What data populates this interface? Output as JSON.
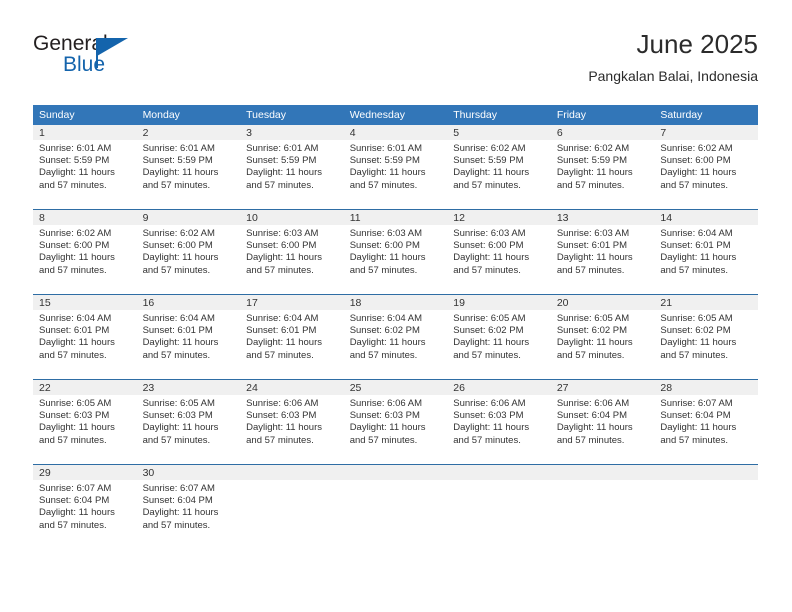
{
  "brand": {
    "name_part1": "General",
    "name_part2": "Blue",
    "logo_icon": "triangle-flag-icon",
    "accent_color": "#1464ac"
  },
  "header": {
    "title": "June 2025",
    "subtitle": "Pangkalan Balai, Indonesia"
  },
  "colors": {
    "header_row_bg": "#3276b8",
    "week_separator": "#2e6da4",
    "daynum_strip_bg": "#f0f0f0",
    "text": "#333333"
  },
  "calendar": {
    "weekday_headers": [
      "Sunday",
      "Monday",
      "Tuesday",
      "Wednesday",
      "Thursday",
      "Friday",
      "Saturday"
    ],
    "weeks": [
      [
        {
          "day": "1",
          "sunrise": "Sunrise: 6:01 AM",
          "sunset": "Sunset: 5:59 PM",
          "daylight_line1": "Daylight: 11 hours",
          "daylight_line2": "and 57 minutes."
        },
        {
          "day": "2",
          "sunrise": "Sunrise: 6:01 AM",
          "sunset": "Sunset: 5:59 PM",
          "daylight_line1": "Daylight: 11 hours",
          "daylight_line2": "and 57 minutes."
        },
        {
          "day": "3",
          "sunrise": "Sunrise: 6:01 AM",
          "sunset": "Sunset: 5:59 PM",
          "daylight_line1": "Daylight: 11 hours",
          "daylight_line2": "and 57 minutes."
        },
        {
          "day": "4",
          "sunrise": "Sunrise: 6:01 AM",
          "sunset": "Sunset: 5:59 PM",
          "daylight_line1": "Daylight: 11 hours",
          "daylight_line2": "and 57 minutes."
        },
        {
          "day": "5",
          "sunrise": "Sunrise: 6:02 AM",
          "sunset": "Sunset: 5:59 PM",
          "daylight_line1": "Daylight: 11 hours",
          "daylight_line2": "and 57 minutes."
        },
        {
          "day": "6",
          "sunrise": "Sunrise: 6:02 AM",
          "sunset": "Sunset: 5:59 PM",
          "daylight_line1": "Daylight: 11 hours",
          "daylight_line2": "and 57 minutes."
        },
        {
          "day": "7",
          "sunrise": "Sunrise: 6:02 AM",
          "sunset": "Sunset: 6:00 PM",
          "daylight_line1": "Daylight: 11 hours",
          "daylight_line2": "and 57 minutes."
        }
      ],
      [
        {
          "day": "8",
          "sunrise": "Sunrise: 6:02 AM",
          "sunset": "Sunset: 6:00 PM",
          "daylight_line1": "Daylight: 11 hours",
          "daylight_line2": "and 57 minutes."
        },
        {
          "day": "9",
          "sunrise": "Sunrise: 6:02 AM",
          "sunset": "Sunset: 6:00 PM",
          "daylight_line1": "Daylight: 11 hours",
          "daylight_line2": "and 57 minutes."
        },
        {
          "day": "10",
          "sunrise": "Sunrise: 6:03 AM",
          "sunset": "Sunset: 6:00 PM",
          "daylight_line1": "Daylight: 11 hours",
          "daylight_line2": "and 57 minutes."
        },
        {
          "day": "11",
          "sunrise": "Sunrise: 6:03 AM",
          "sunset": "Sunset: 6:00 PM",
          "daylight_line1": "Daylight: 11 hours",
          "daylight_line2": "and 57 minutes."
        },
        {
          "day": "12",
          "sunrise": "Sunrise: 6:03 AM",
          "sunset": "Sunset: 6:00 PM",
          "daylight_line1": "Daylight: 11 hours",
          "daylight_line2": "and 57 minutes."
        },
        {
          "day": "13",
          "sunrise": "Sunrise: 6:03 AM",
          "sunset": "Sunset: 6:01 PM",
          "daylight_line1": "Daylight: 11 hours",
          "daylight_line2": "and 57 minutes."
        },
        {
          "day": "14",
          "sunrise": "Sunrise: 6:04 AM",
          "sunset": "Sunset: 6:01 PM",
          "daylight_line1": "Daylight: 11 hours",
          "daylight_line2": "and 57 minutes."
        }
      ],
      [
        {
          "day": "15",
          "sunrise": "Sunrise: 6:04 AM",
          "sunset": "Sunset: 6:01 PM",
          "daylight_line1": "Daylight: 11 hours",
          "daylight_line2": "and 57 minutes."
        },
        {
          "day": "16",
          "sunrise": "Sunrise: 6:04 AM",
          "sunset": "Sunset: 6:01 PM",
          "daylight_line1": "Daylight: 11 hours",
          "daylight_line2": "and 57 minutes."
        },
        {
          "day": "17",
          "sunrise": "Sunrise: 6:04 AM",
          "sunset": "Sunset: 6:01 PM",
          "daylight_line1": "Daylight: 11 hours",
          "daylight_line2": "and 57 minutes."
        },
        {
          "day": "18",
          "sunrise": "Sunrise: 6:04 AM",
          "sunset": "Sunset: 6:02 PM",
          "daylight_line1": "Daylight: 11 hours",
          "daylight_line2": "and 57 minutes."
        },
        {
          "day": "19",
          "sunrise": "Sunrise: 6:05 AM",
          "sunset": "Sunset: 6:02 PM",
          "daylight_line1": "Daylight: 11 hours",
          "daylight_line2": "and 57 minutes."
        },
        {
          "day": "20",
          "sunrise": "Sunrise: 6:05 AM",
          "sunset": "Sunset: 6:02 PM",
          "daylight_line1": "Daylight: 11 hours",
          "daylight_line2": "and 57 minutes."
        },
        {
          "day": "21",
          "sunrise": "Sunrise: 6:05 AM",
          "sunset": "Sunset: 6:02 PM",
          "daylight_line1": "Daylight: 11 hours",
          "daylight_line2": "and 57 minutes."
        }
      ],
      [
        {
          "day": "22",
          "sunrise": "Sunrise: 6:05 AM",
          "sunset": "Sunset: 6:03 PM",
          "daylight_line1": "Daylight: 11 hours",
          "daylight_line2": "and 57 minutes."
        },
        {
          "day": "23",
          "sunrise": "Sunrise: 6:05 AM",
          "sunset": "Sunset: 6:03 PM",
          "daylight_line1": "Daylight: 11 hours",
          "daylight_line2": "and 57 minutes."
        },
        {
          "day": "24",
          "sunrise": "Sunrise: 6:06 AM",
          "sunset": "Sunset: 6:03 PM",
          "daylight_line1": "Daylight: 11 hours",
          "daylight_line2": "and 57 minutes."
        },
        {
          "day": "25",
          "sunrise": "Sunrise: 6:06 AM",
          "sunset": "Sunset: 6:03 PM",
          "daylight_line1": "Daylight: 11 hours",
          "daylight_line2": "and 57 minutes."
        },
        {
          "day": "26",
          "sunrise": "Sunrise: 6:06 AM",
          "sunset": "Sunset: 6:03 PM",
          "daylight_line1": "Daylight: 11 hours",
          "daylight_line2": "and 57 minutes."
        },
        {
          "day": "27",
          "sunrise": "Sunrise: 6:06 AM",
          "sunset": "Sunset: 6:04 PM",
          "daylight_line1": "Daylight: 11 hours",
          "daylight_line2": "and 57 minutes."
        },
        {
          "day": "28",
          "sunrise": "Sunrise: 6:07 AM",
          "sunset": "Sunset: 6:04 PM",
          "daylight_line1": "Daylight: 11 hours",
          "daylight_line2": "and 57 minutes."
        }
      ],
      [
        {
          "day": "29",
          "sunrise": "Sunrise: 6:07 AM",
          "sunset": "Sunset: 6:04 PM",
          "daylight_line1": "Daylight: 11 hours",
          "daylight_line2": "and 57 minutes."
        },
        {
          "day": "30",
          "sunrise": "Sunrise: 6:07 AM",
          "sunset": "Sunset: 6:04 PM",
          "daylight_line1": "Daylight: 11 hours",
          "daylight_line2": "and 57 minutes."
        },
        {
          "day": "",
          "sunrise": "",
          "sunset": "",
          "daylight_line1": "",
          "daylight_line2": ""
        },
        {
          "day": "",
          "sunrise": "",
          "sunset": "",
          "daylight_line1": "",
          "daylight_line2": ""
        },
        {
          "day": "",
          "sunrise": "",
          "sunset": "",
          "daylight_line1": "",
          "daylight_line2": ""
        },
        {
          "day": "",
          "sunrise": "",
          "sunset": "",
          "daylight_line1": "",
          "daylight_line2": ""
        },
        {
          "day": "",
          "sunrise": "",
          "sunset": "",
          "daylight_line1": "",
          "daylight_line2": ""
        }
      ]
    ]
  }
}
